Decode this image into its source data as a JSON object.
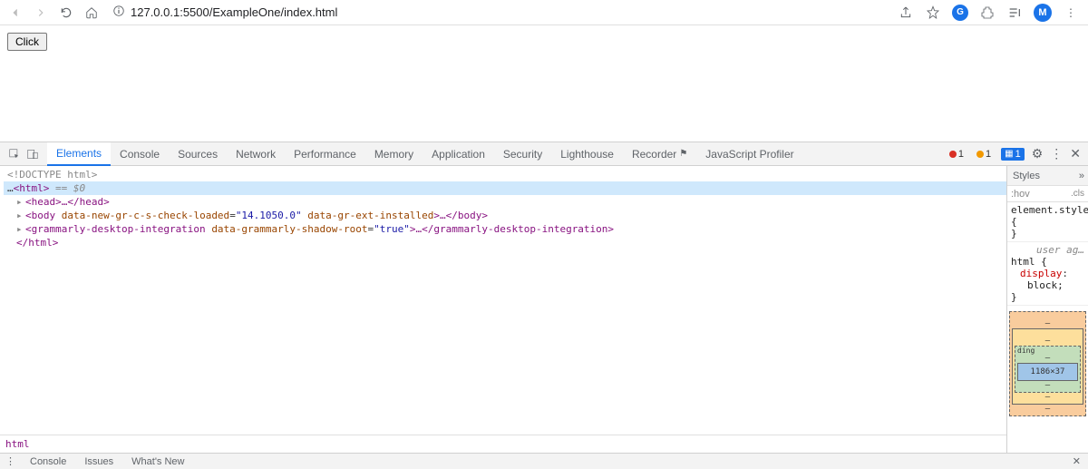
{
  "chrome": {
    "url": "127.0.0.1:5500/ExampleOne/index.html",
    "avatar_initial": "M",
    "g_initial": "G"
  },
  "page": {
    "button_label": "Click"
  },
  "devtools": {
    "tabs": [
      "Elements",
      "Console",
      "Sources",
      "Network",
      "Performance",
      "Memory",
      "Application",
      "Security",
      "Lighthouse",
      "Recorder",
      "JavaScript Profiler"
    ],
    "active_tab": "Elements",
    "errors": "1",
    "warnings": "1",
    "issues": "1",
    "dom": {
      "doctype": "<!DOCTYPE html>",
      "html_open": "<html>",
      "sel_marker": " == $0",
      "head": "<head>…</head>",
      "body_open": "<body ",
      "body_attr1_name": "data-new-gr-c-s-check-loaded",
      "body_attr1_val": "\"14.1050.0\"",
      "body_attr2_name": "data-gr-ext-installed",
      "body_mid": ">…",
      "body_close": "</body>",
      "gdi_open": "<grammarly-desktop-integration ",
      "gdi_attr_name": "data-grammarly-shadow-root",
      "gdi_attr_val": "\"true\"",
      "gdi_mid": ">…",
      "gdi_close": "</grammarly-desktop-integration>",
      "html_close": "</html>"
    },
    "breadcrumb": "html",
    "styles": {
      "tab": "Styles",
      "filter_hov": ":hov",
      "filter_cls": ".cls",
      "element_style_sel": "element.style",
      "brace_open": " {",
      "brace_close": "}",
      "ua_label": "user ag…",
      "html_sel": "html",
      "display_prop": "display",
      "display_colon": ":",
      "display_val": "block;"
    },
    "box_model": {
      "content": "1186×37",
      "dash": "–",
      "padding_label": "ding"
    },
    "drawer": {
      "tabs": [
        "Console",
        "Issues",
        "What's New"
      ]
    }
  }
}
